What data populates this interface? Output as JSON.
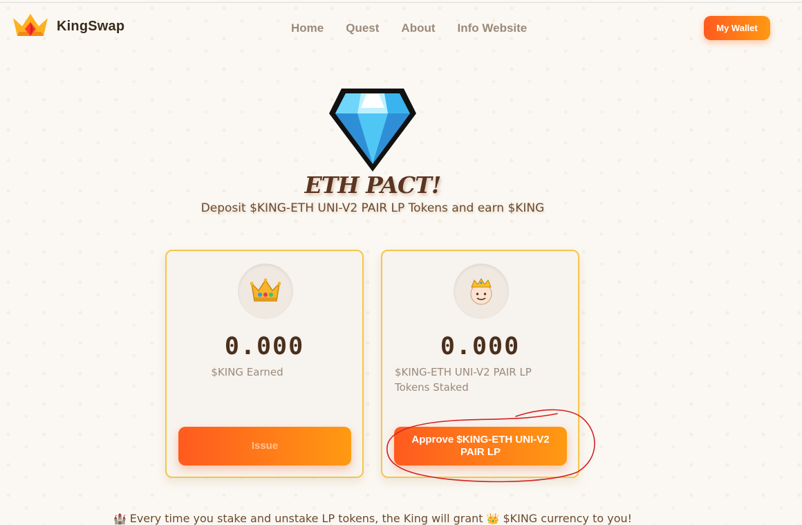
{
  "header": {
    "brand": "KingSwap",
    "nav": [
      "Home",
      "Quest",
      "About",
      "Info Website"
    ],
    "wallet_label": "My Wallet"
  },
  "hero": {
    "title": "ETH PACT!",
    "subtitle": "Deposit $KING-ETH UNI-V2 PAIR LP Tokens and earn $KING"
  },
  "cards": [
    {
      "icon": "crown-icon",
      "value": "0.000",
      "label": "$KING Earned",
      "button": "Issue"
    },
    {
      "icon": "king-face-icon",
      "value": "0.000",
      "label": "$KING-ETH UNI-V2 PAIR LP Tokens Staked",
      "button": "Approve $KING-ETH UNI-V2 PAIR LP"
    }
  ],
  "footer": {
    "text_before": "Every time you stake and unstake LP tokens, the King will grant",
    "text_after": "$KING currency to you!"
  },
  "colors": {
    "accent_start": "#ff5a1f",
    "accent_end": "#ff9a12",
    "card_border": "#f5c54a",
    "annotation": "#d42020"
  }
}
